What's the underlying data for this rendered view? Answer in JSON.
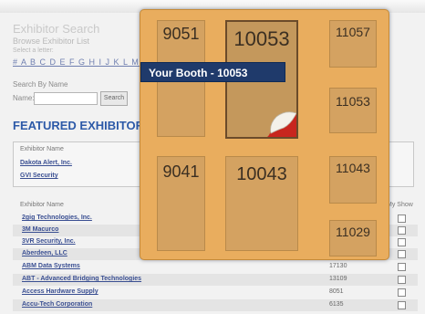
{
  "directory": {
    "title": "Exhibitor Search",
    "browse_label": "Browse Exhibitor List",
    "select_letter": "Select a letter:",
    "letters": "# A B C D E F G H I J K L M N O P",
    "search_by": "Search By Name",
    "name_label": "Name:",
    "search_button": "Search",
    "featured_title": "FEATURED EXHIBITORS",
    "featured_header": "Exhibitor Name",
    "featured": [
      "Dakota Alert, Inc.",
      "GVI Security"
    ],
    "list_header": "Exhibitor Name",
    "my_show": "My Show",
    "rows": [
      {
        "name": "2gig Technologies, Inc.",
        "booth": ""
      },
      {
        "name": "3M Macurco",
        "booth": ""
      },
      {
        "name": "3VR Security, Inc.",
        "booth": ""
      },
      {
        "name": "Aberdeen, LLC",
        "booth": ""
      },
      {
        "name": "ABM Data Systems",
        "booth": "17130"
      },
      {
        "name": "ABT - Advanced Bridging Technologies",
        "booth": "13109"
      },
      {
        "name": "Access Hardware Supply",
        "booth": "8051"
      },
      {
        "name": "Accu-Tech Corporation",
        "booth": "6135"
      }
    ]
  },
  "floorplan": {
    "tooltip": "Your Booth  - 10053",
    "booths": [
      "9051",
      "10053",
      "11057",
      "11053",
      "9041",
      "10043",
      "11043",
      "11029"
    ],
    "selected_booth": "10053",
    "colors": {
      "floor": "#e9ad5e",
      "booth": "#d4a261",
      "tooltip": "#1f3a6b"
    }
  }
}
